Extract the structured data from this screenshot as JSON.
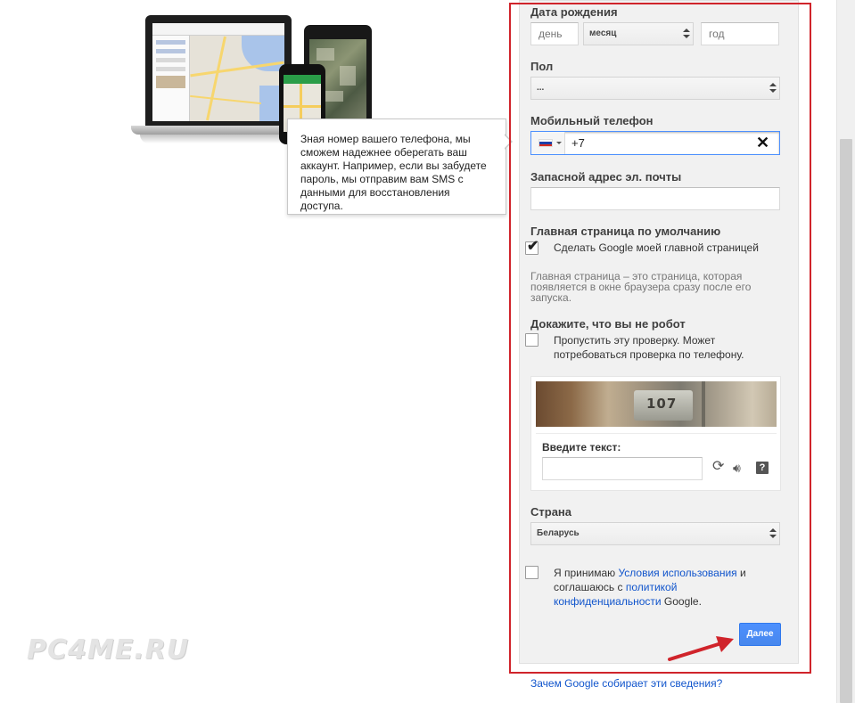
{
  "tooltip": {
    "text": "Зная номер вашего телефона, мы сможем надежнее оберегать ваш аккаунт. Например, если вы забудете пароль, мы отправим вам SMS с данными для восстановления доступа."
  },
  "birth_date": {
    "label": "Дата рождения",
    "day_placeholder": "день",
    "month_value": "месяц",
    "year_placeholder": "год"
  },
  "gender": {
    "label": "Пол",
    "value": "..."
  },
  "mobile_phone": {
    "label": "Мобильный телефон",
    "country_flag": "russia-flag",
    "value": "+7"
  },
  "backup_email": {
    "label": "Запасной адрес эл. почты",
    "value": ""
  },
  "default_homepage": {
    "label": "Главная страница по умолчанию",
    "checkbox_label": "Сделать Google моей главной страницей",
    "checked": true,
    "note": "Главная страница – это страница, которая появляется в окне браузера сразу после его запуска."
  },
  "robot_check": {
    "label": "Докажите, что вы не робот",
    "skip_label": "Пропустить эту проверку. Может потребоваться проверка по телефону.",
    "checked": false
  },
  "captcha": {
    "image_text": "107",
    "input_label": "Введите текст:",
    "value": "",
    "icons": [
      "refresh-icon",
      "audio-icon",
      "help-icon"
    ]
  },
  "country": {
    "label": "Страна",
    "value": "Беларусь"
  },
  "terms": {
    "checked": false,
    "text_1": "Я принимаю ",
    "terms_link": "Условия использования",
    "text_2": " и соглашаюсь с ",
    "privacy_link": "политикой конфиденциальности",
    "text_3": " Google."
  },
  "next_button": "Далее",
  "why_link": "Зачем Google собирает эти сведения?",
  "watermark": "PC4ME.RU",
  "colors": {
    "accent_blue": "#4d90fe",
    "link_blue": "#1155cc",
    "highlight_red": "#d0242b"
  }
}
